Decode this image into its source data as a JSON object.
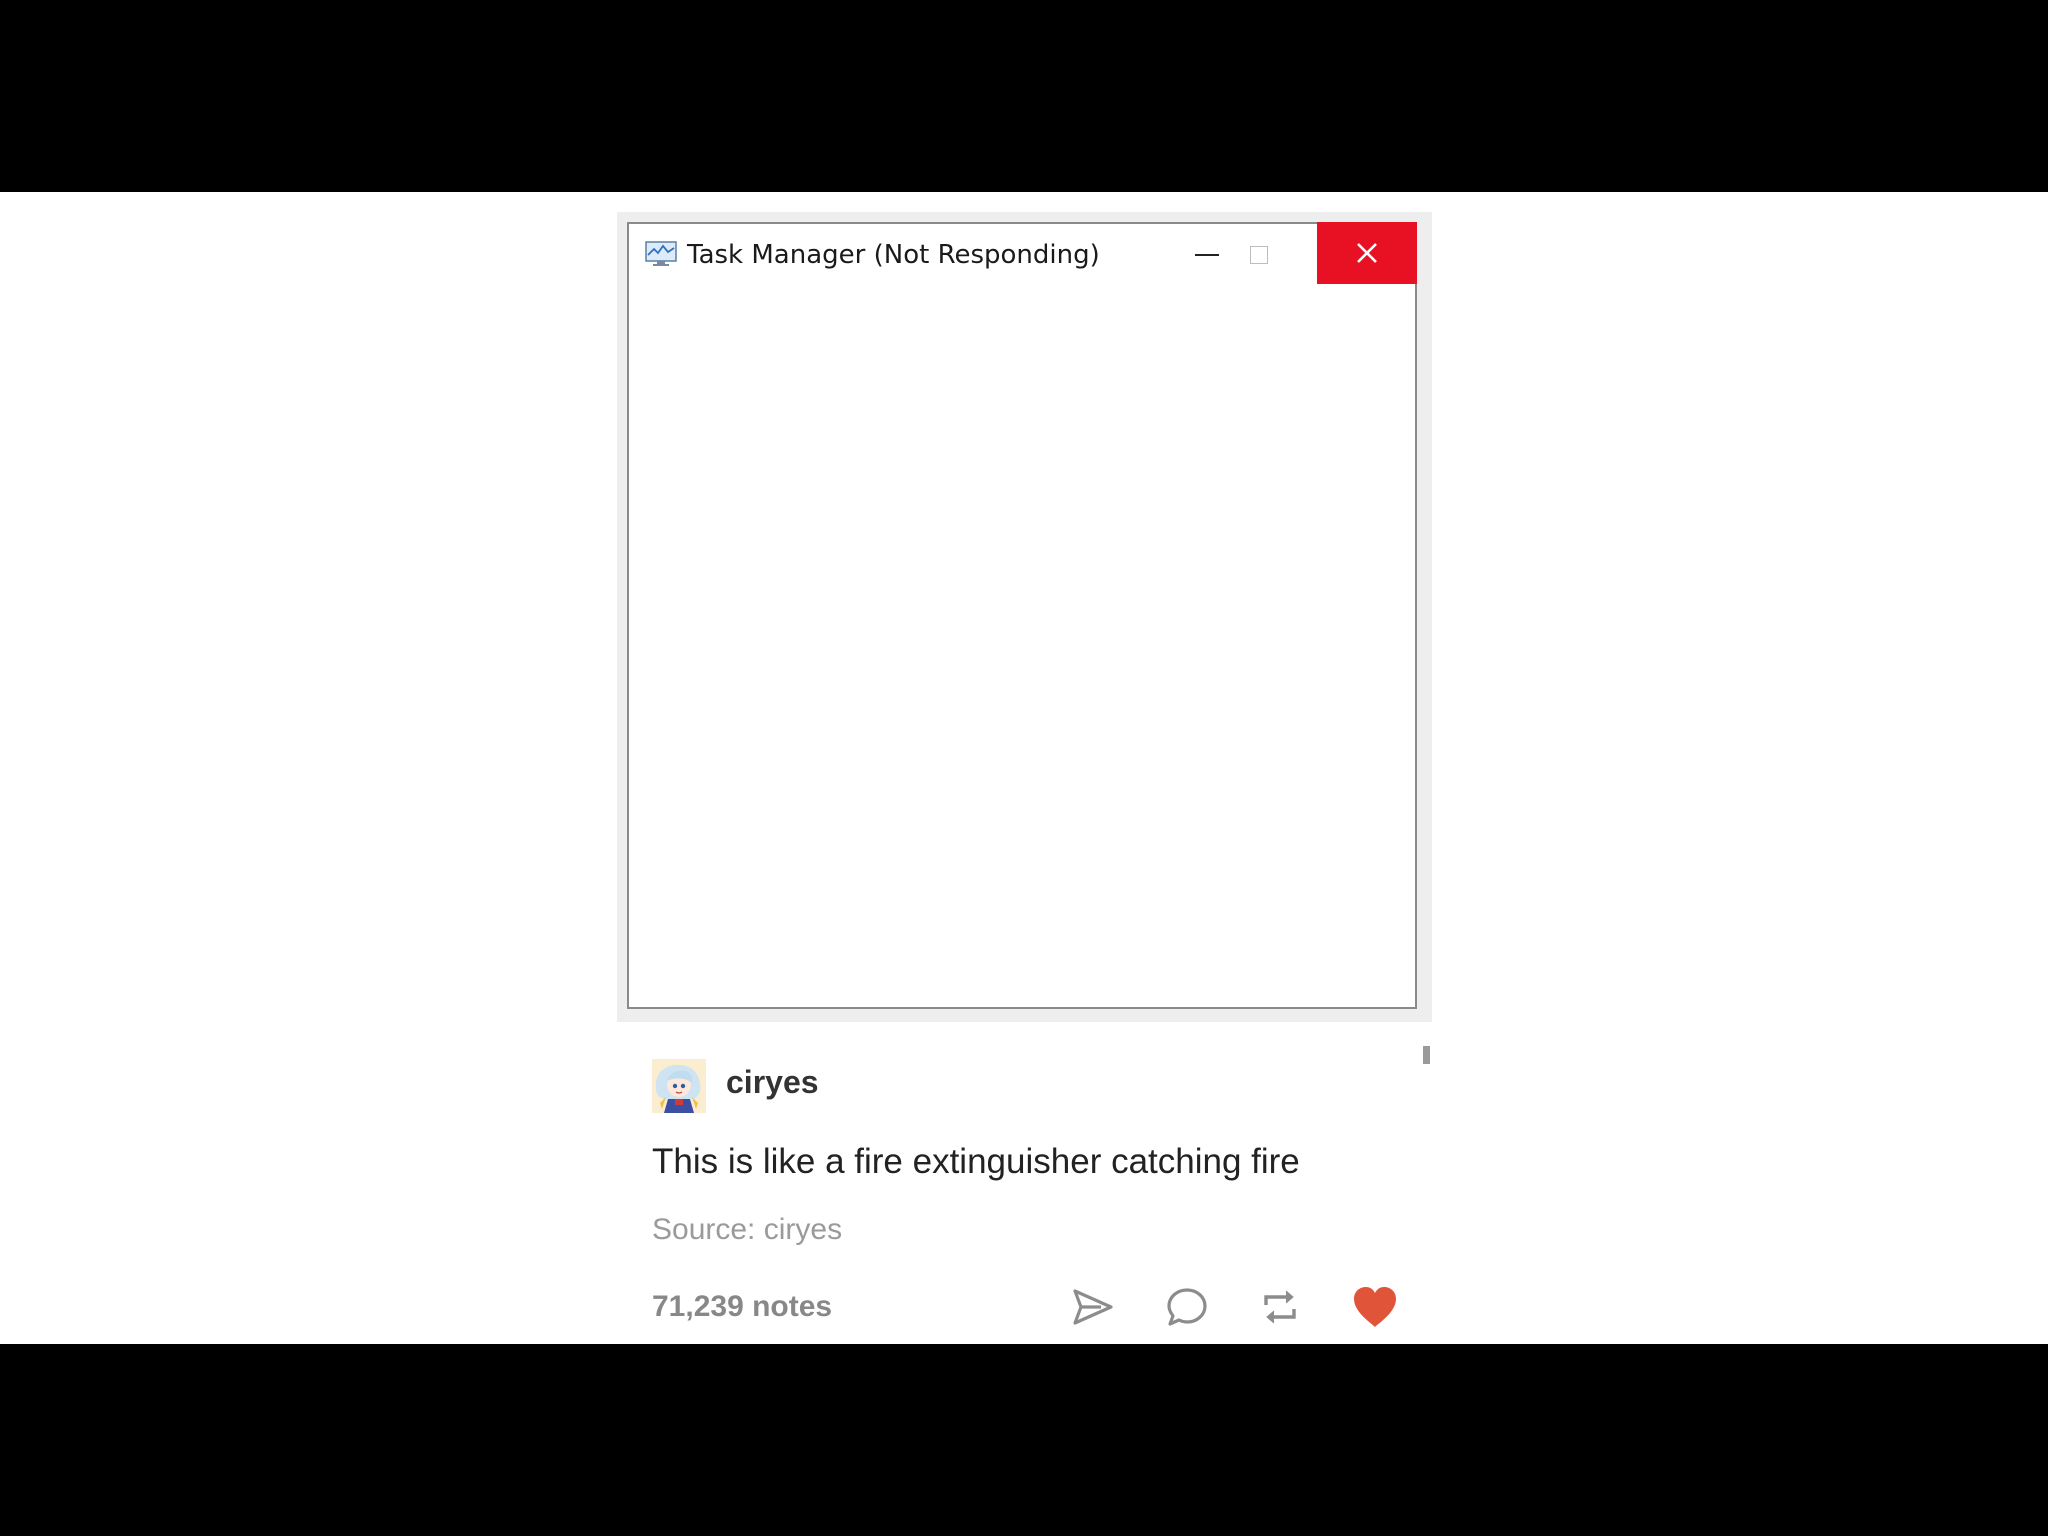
{
  "window": {
    "title": "Task Manager (Not Responding)",
    "app_icon": "task-manager-icon",
    "controls": {
      "minimize_icon": "minimize-icon",
      "maximize_icon": "maximize-icon",
      "close_icon": "close-icon",
      "close_color": "#e81123"
    }
  },
  "post": {
    "username": "ciryes",
    "avatar": "avatar-image",
    "text": "This is like a fire extinguisher catching fire",
    "source_label": "Source: ciryes",
    "notes": "71,239 notes",
    "actions": [
      {
        "icon": "share-icon"
      },
      {
        "icon": "reply-icon"
      },
      {
        "icon": "reblog-icon"
      },
      {
        "icon": "heart-icon",
        "color": "#e0553a"
      }
    ]
  }
}
